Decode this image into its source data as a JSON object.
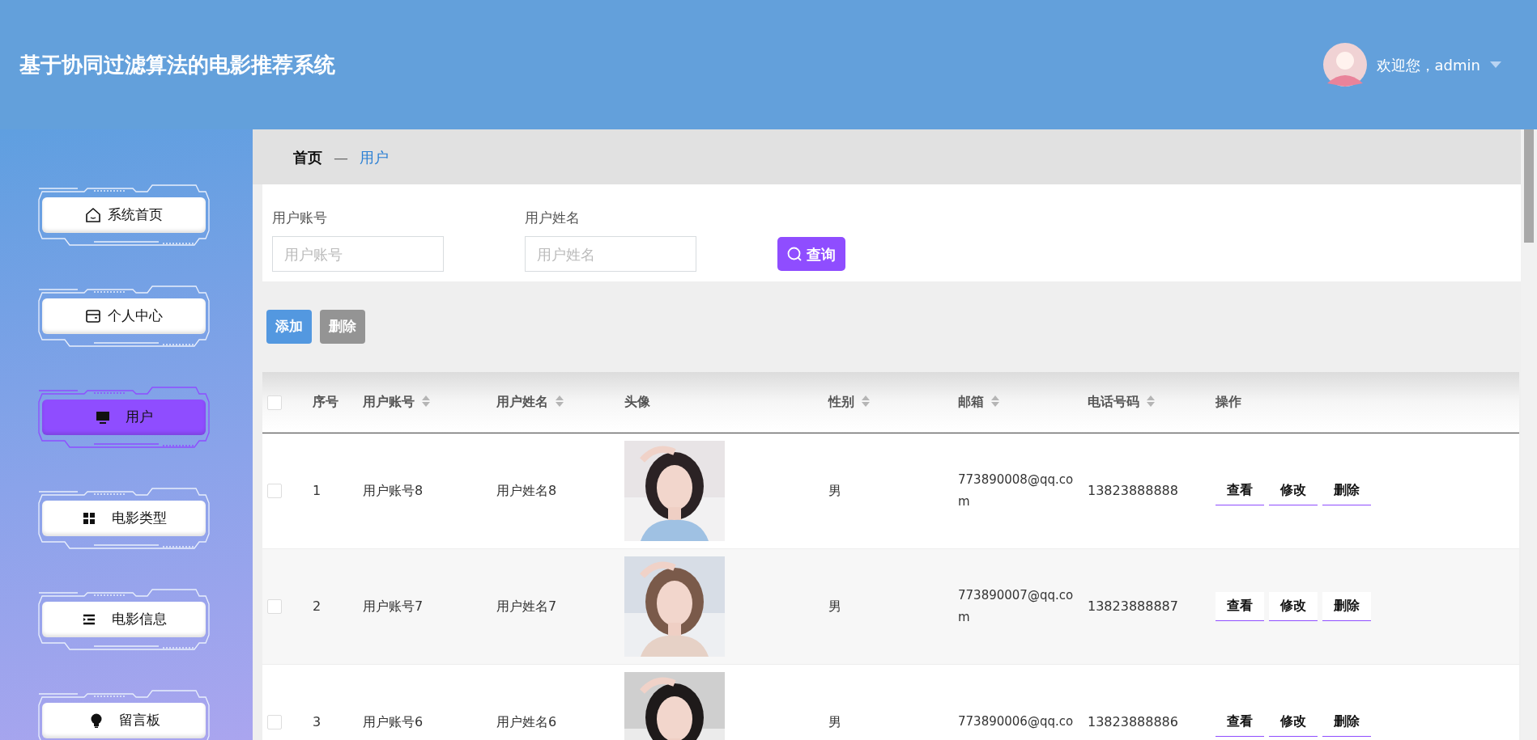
{
  "header": {
    "title": "基于协同过滤算法的电影推荐系统",
    "greeting": "欢迎您，admin"
  },
  "sidebar": {
    "items": [
      {
        "label": "系统首页",
        "selected": false
      },
      {
        "label": "个人中心",
        "selected": false
      },
      {
        "label": "用户",
        "selected": true
      },
      {
        "label": "电影类型",
        "selected": false
      },
      {
        "label": "电影信息",
        "selected": false
      },
      {
        "label": "留言板",
        "selected": false
      }
    ]
  },
  "breadcrumb": [
    {
      "label": "首页",
      "selected": false
    },
    {
      "label": "—",
      "kind": "separator"
    },
    {
      "label": "用户",
      "selected": true
    }
  ],
  "search": {
    "fields": [
      {
        "label": "用户账号",
        "placeholder": "用户账号"
      },
      {
        "label": "用户姓名",
        "placeholder": "用户姓名"
      }
    ],
    "button": "查询"
  },
  "actions": [
    {
      "label": "添加",
      "kind": "primary"
    },
    {
      "label": "删除",
      "kind": "secondary"
    }
  ],
  "table": {
    "select_all": {
      "checked": false
    },
    "columns": [
      {
        "label": "序号",
        "sortable": false
      },
      {
        "label": "用户账号",
        "sortable": true
      },
      {
        "label": "用户姓名",
        "sortable": true
      },
      {
        "label": "头像",
        "sortable": false
      },
      {
        "label": "性别",
        "sortable": true
      },
      {
        "label": "邮箱",
        "sortable": true
      },
      {
        "label": "电话号码",
        "sortable": true
      },
      {
        "label": "操作",
        "sortable": false
      }
    ],
    "rows": [
      {
        "checked": false,
        "index": "1",
        "account": "用户账号8",
        "name": "用户姓名8",
        "gender": "男",
        "email": "773890008@qq.com",
        "phone": "13823888888",
        "buttons": [
          "查看",
          "修改",
          "删除"
        ]
      },
      {
        "checked": false,
        "index": "2",
        "account": "用户账号7",
        "name": "用户姓名7",
        "gender": "男",
        "email": "773890007@qq.com",
        "phone": "13823888887",
        "buttons": [
          "查看",
          "修改",
          "删除"
        ]
      },
      {
        "checked": false,
        "index": "3",
        "account": "用户账号6",
        "name": "用户姓名6",
        "gender": "男",
        "email": "773890006@qq.co",
        "phone": "13823888886",
        "buttons": [
          "查看",
          "修改",
          "删除"
        ]
      }
    ]
  }
}
